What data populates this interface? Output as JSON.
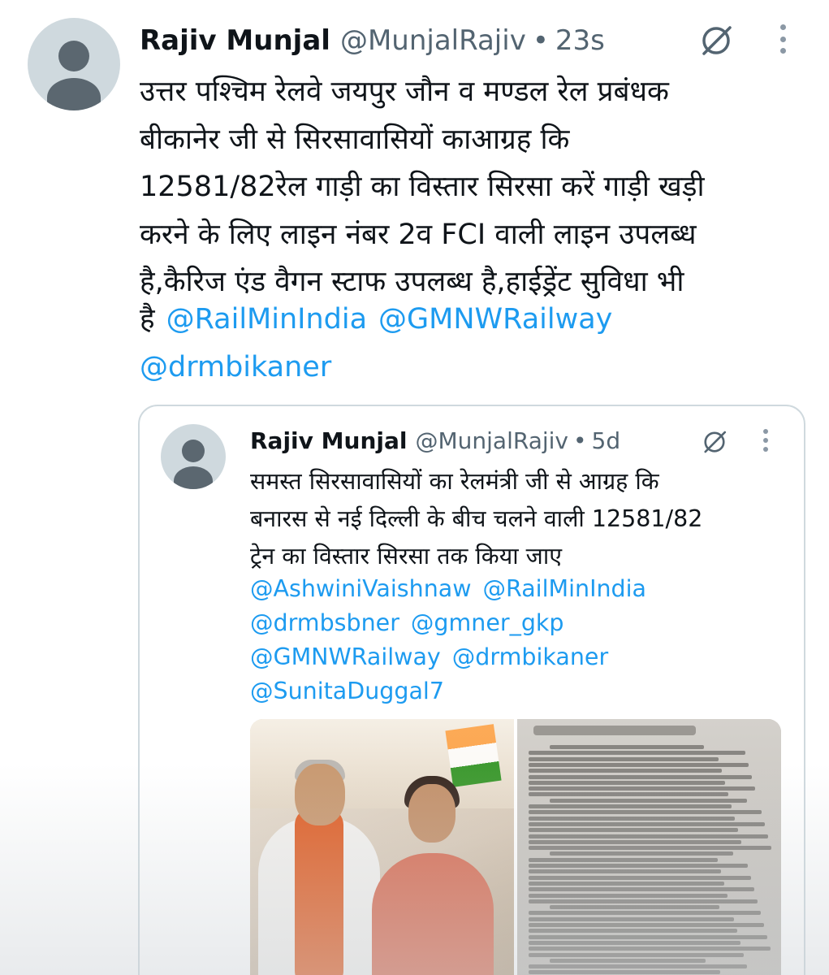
{
  "tweet": {
    "author_name": "Rajiv Munjal",
    "author_handle": "@MunjalRajiv",
    "separator": "•",
    "time": "23s",
    "text": "उत्तर पश्चिम रेलवे जयपुर जौन व मण्डल रेल प्रबंधक\nबीकानेर जी से सिरसावासियों काआग्रह कि\n12581/82रेल गाड़ी का विस्तार सिरसा करें गाड़ी खड़ी\nकरने के लिए लाइन नंबर 2व FCI वाली लाइन उपलब्ध\nहै,कैरिज एंड वैगन स्टाफ उपलब्ध है,हाईड्रेंट सुविधा भी",
    "text_tail": "है",
    "mentions": [
      "@RailMinIndia",
      "@GMNWRailway",
      "@drmbikaner"
    ],
    "icons": [
      "grok-icon",
      "more-vertical-icon"
    ]
  },
  "quoted_tweet": {
    "author_name": "Rajiv Munjal",
    "author_handle": "@MunjalRajiv",
    "separator": "•",
    "time": "5d",
    "text": "समस्त सिरसावासियों का रेलमंत्री जी से आग्रह कि\nबनारस से नई दिल्ली के बीच चलने वाली 12581/82\nट्रेन का विस्तार सिरसा तक किया जाए",
    "mentions": [
      "@AshwiniVaishnaw",
      "@RailMinIndia",
      "@drmbsbner",
      "@gmner_gkp",
      "@GMNWRailway",
      "@drmbikaner",
      "@SunitaDuggal7"
    ],
    "icons": [
      "grok-icon",
      "more-vertical-icon"
    ],
    "media": [
      "photo-two-people-greeting",
      "photo-handwritten-letter"
    ]
  },
  "colors": {
    "link": "#1d9bf0",
    "text": "#0f1419",
    "secondary": "#536471",
    "border": "#cfd9de"
  }
}
